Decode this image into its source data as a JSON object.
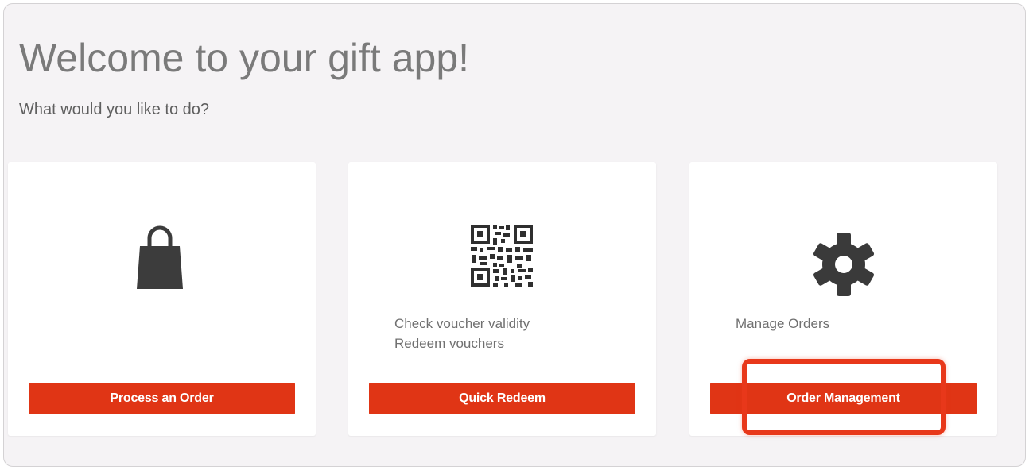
{
  "header": {
    "title": "Welcome to your gift app!",
    "subtitle": "What would you like to do?"
  },
  "cards": [
    {
      "icon": "shopping-bag-icon",
      "lines": [],
      "button_label": "Process an Order"
    },
    {
      "icon": "qr-code-icon",
      "lines": [
        "Check voucher validity",
        "Redeem vouchers"
      ],
      "button_label": "Quick Redeem"
    },
    {
      "icon": "gear-icon",
      "lines": [
        "Manage Orders"
      ],
      "button_label": "Order Management"
    }
  ],
  "colors": {
    "accent": "#e03515",
    "background": "#f5f3f5",
    "highlight": "#e8381a"
  }
}
